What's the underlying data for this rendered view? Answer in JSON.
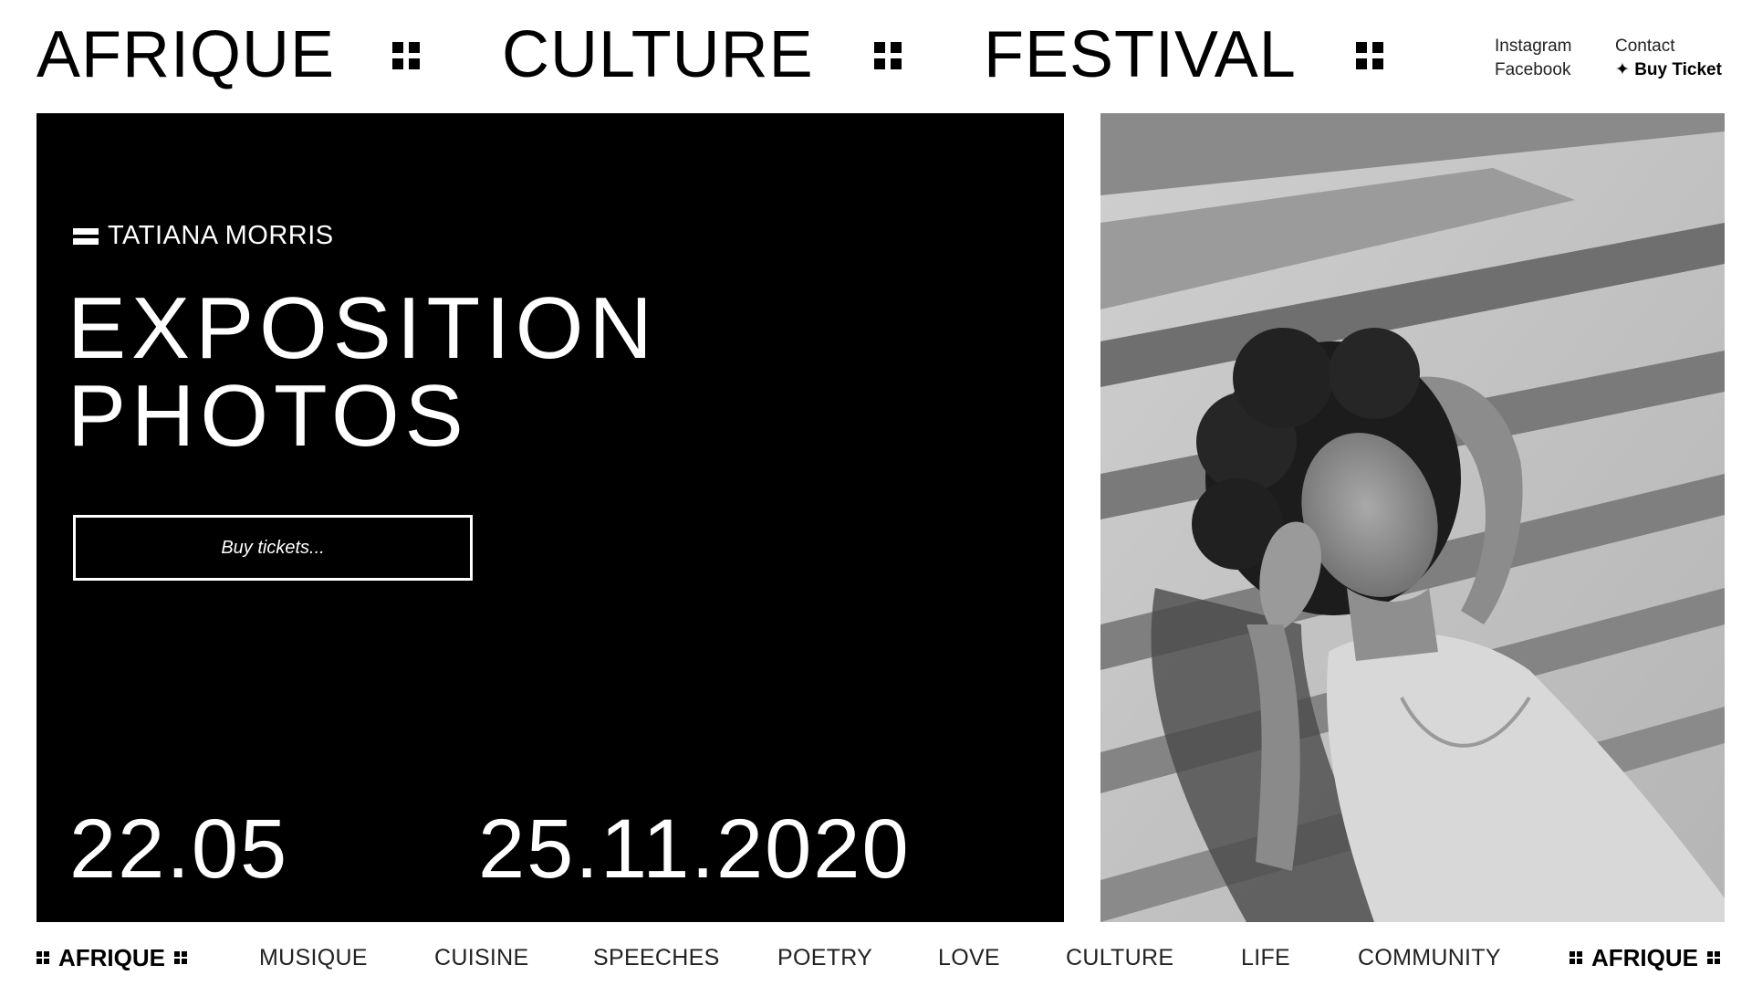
{
  "header": {
    "brand_words": [
      "AFRIQUE",
      "CULTURE",
      "FESTIVAL"
    ],
    "social_links": [
      "Instagram",
      "Facebook"
    ],
    "contact_label": "Contact",
    "buy_ticket_label": "✦ Buy Ticket"
  },
  "hero": {
    "author": "TATIANA MORRIS",
    "title_lines": [
      "EXPOSITION",
      "PHOTOS"
    ],
    "button_label": "Buy tickets...",
    "date_start": "22.05",
    "date_end": "25.11.2020",
    "background_color": "#000000",
    "text_color": "#ffffff"
  },
  "photo": {
    "style": "black-and-white"
  },
  "bottom_nav": {
    "brand_left": "AFRIQUE",
    "items": [
      "MUSIQUE",
      "CUISINE",
      "SPEECHES",
      "POETRY",
      "LOVE",
      "CULTURE",
      "LIFE",
      "COMMUNITY"
    ],
    "brand_right": "AFRIQUE"
  }
}
